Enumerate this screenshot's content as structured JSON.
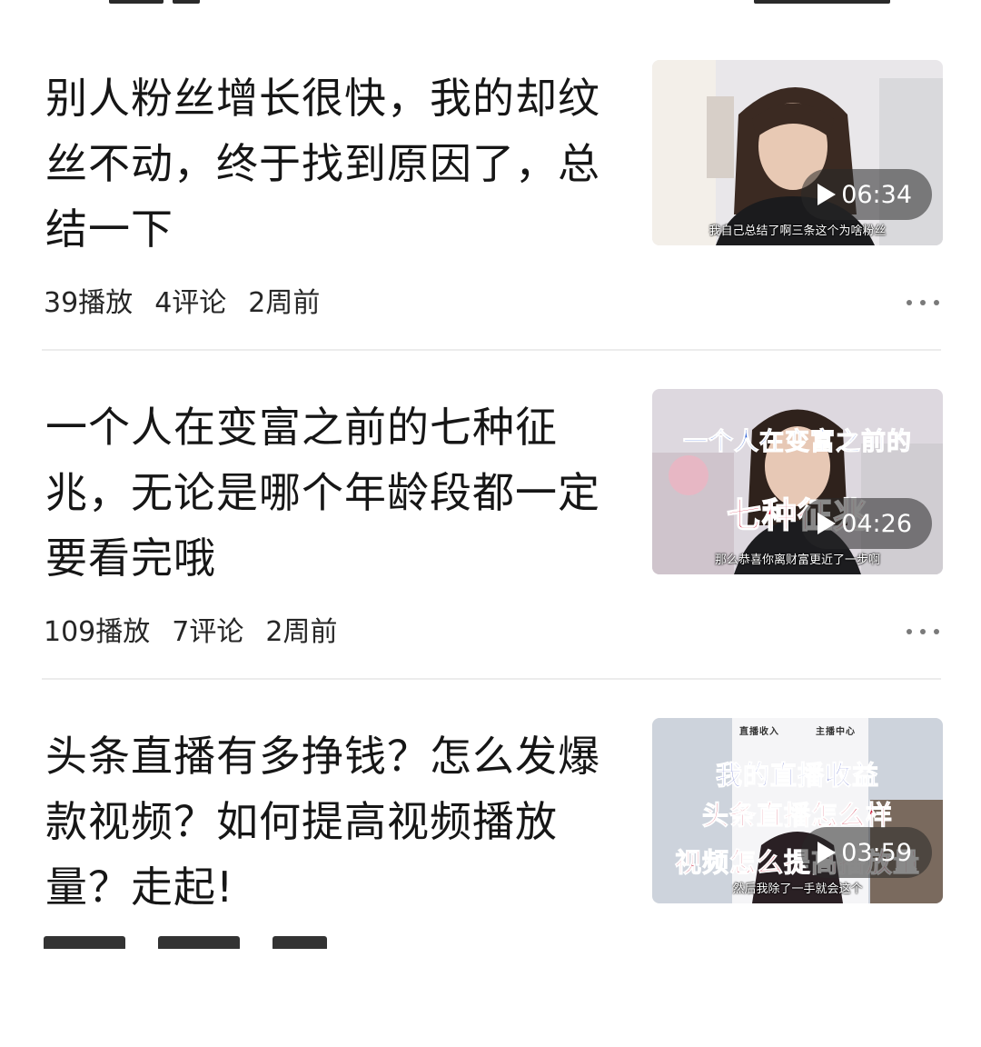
{
  "feed": {
    "items": [
      {
        "title": "别人粉丝增长很快，我的却纹丝不动，终于找到原因了，总结一下",
        "plays": "39播放",
        "comments": "4评论",
        "time": "2周前",
        "duration": "06:34",
        "thumb_subtitle": "我自己总结了啊三条这个为啥粉丝",
        "thumb_overlay_lines": []
      },
      {
        "title": "一个人在变富之前的七种征兆，无论是哪个年龄段都一定要看完哦",
        "plays": "109播放",
        "comments": "7评论",
        "time": "2周前",
        "duration": "04:26",
        "thumb_subtitle": "那么恭喜你离财富更近了一步啊",
        "thumb_overlay_lines": [
          "一个人在变富之前的",
          "七种征兆"
        ]
      },
      {
        "title": "头条直播有多挣钱？怎么发爆款视频？如何提高视频播放量？走起!",
        "plays": "",
        "comments": "",
        "time": "",
        "duration": "03:59",
        "thumb_subtitle": "然后我除了一手就会这个",
        "thumb_overlay_lines": [
          "我的直播收益",
          "头条直播怎么样",
          "视频怎么提高播放量"
        ],
        "thumb_header_left": "直播收入",
        "thumb_header_right": "主播中心"
      }
    ]
  },
  "icons": {
    "play": "play-icon",
    "more": "more-dots-icon"
  },
  "colors": {
    "title": "#161616",
    "meta": "#262626",
    "divider": "#ececec",
    "overlay_blue": "#2f5fd6",
    "overlay_red": "#c8102e"
  }
}
